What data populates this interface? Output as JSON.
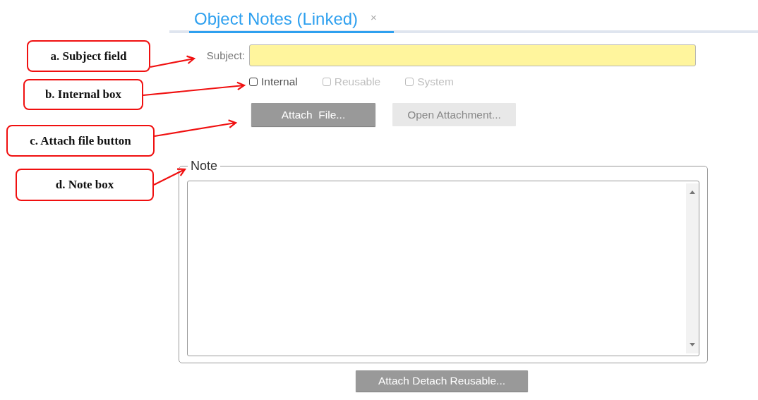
{
  "tab": {
    "title": "Object Notes (Linked)",
    "close": "×",
    "selected": true
  },
  "subject": {
    "label": "Subject:"
  },
  "checkboxes": [
    {
      "label": "Internal",
      "checked": false,
      "disabled": false
    },
    {
      "label": "Reusable",
      "checked": false,
      "disabled": true
    },
    {
      "label": "System",
      "checked": false,
      "disabled": true
    }
  ],
  "buttons": [
    {
      "label": "Attach  File...",
      "disabled": false
    },
    {
      "label": "Open Attachment...",
      "disabled": true
    }
  ],
  "note": {
    "legend": "Note"
  },
  "bottom_button": {
    "label": "Attach Detach Reusable...",
    "disabled": false
  },
  "callouts": [
    {
      "text": "a. Subject field"
    },
    {
      "text": "b. Internal box"
    },
    {
      "text": "c. Attach file button"
    },
    {
      "text": "d. Note box"
    }
  ]
}
